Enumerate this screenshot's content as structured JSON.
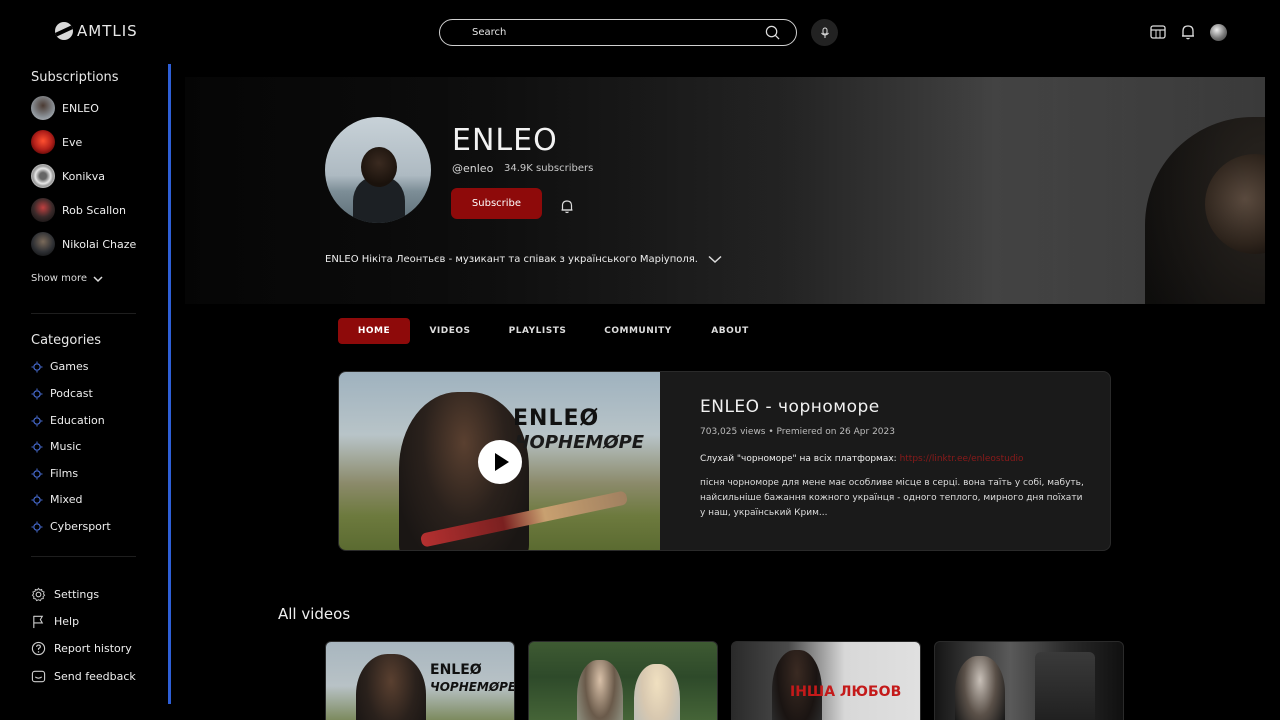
{
  "app": {
    "logo": "AMTLIS"
  },
  "search": {
    "placeholder": "Search"
  },
  "sidebar": {
    "subscriptions_title": "Subscriptions",
    "subscriptions": [
      {
        "name": "ENLEO",
        "color": "#6b6e72"
      },
      {
        "name": "Eve",
        "color": "#b3201a"
      },
      {
        "name": "Konikva",
        "color": "#d8d8d8"
      },
      {
        "name": "Rob Scallon",
        "color": "#3a2a2a"
      },
      {
        "name": "Nikolai Chaze",
        "color": "#2e3034"
      }
    ],
    "show_more": "Show more",
    "categories_title": "Categories",
    "categories": [
      "Games",
      "Podcast",
      "Education",
      "Music",
      "Films",
      "Mixed",
      "Cybersport"
    ],
    "footer": [
      {
        "label": "Settings",
        "icon": "gear-icon"
      },
      {
        "label": "Help",
        "icon": "flag-icon"
      },
      {
        "label": "Report history",
        "icon": "question-icon"
      },
      {
        "label": "Send feedback",
        "icon": "feedback-icon"
      }
    ]
  },
  "channel": {
    "name": "ENLEO",
    "handle": "@enleo",
    "subscribers": "34.9K subscribers",
    "subscribe_label": "Subscribe",
    "description": "ENLEO Нікіта Леонтьєв - музикант та співак з українського Маріуполя."
  },
  "tabs": [
    "HOME",
    "VIDEOS",
    "PLAYLISTS",
    "COMMUNITY",
    "ABOUT"
  ],
  "active_tab": "HOME",
  "featured": {
    "title": "ENLEO - чорноморе",
    "meta": "703,025 views • Premiered on 26 Apr 2023",
    "line1": "Слухай \"чорноморе\" на всіх платформах:",
    "link": "https://linktr.ee/enleostudio",
    "line2": "пісня чорноморе для мене має особливе місце в серці. вона таїть у собі, мабуть, найсильніше бажання кожного українця - одного теплого, мирного дня поїхати у наш, український Крим...",
    "thumb_title": "ENLEØ",
    "thumb_sub": "ЧОРНЕМØРЕ"
  },
  "all_videos": {
    "title": "All videos",
    "items": [
      {
        "text_a": "ENLEØ",
        "text_b": "ЧОРНЕМØРЕ"
      },
      {
        "text_a": "",
        "text_b": ""
      },
      {
        "text_a": "ІНША ЛЮБОВ",
        "text_b": ""
      },
      {
        "text_a": "",
        "text_b": ""
      }
    ]
  },
  "colors": {
    "accent": "#8e0a0a",
    "rail": "#2e5fd6",
    "background": "#000000"
  }
}
